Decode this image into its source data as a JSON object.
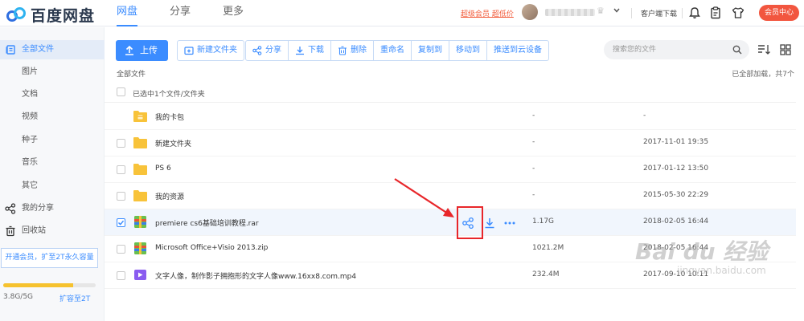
{
  "app": {
    "logo_text": "百度网盘"
  },
  "nav": {
    "items": [
      {
        "label": "网盘"
      },
      {
        "label": "分享"
      },
      {
        "label": "更多"
      }
    ]
  },
  "header": {
    "super_vip": "超级会员 超低价",
    "client_download": "客户端下载",
    "vip_center": "会员中心"
  },
  "sidebar": {
    "items": [
      {
        "label": "全部文件"
      },
      {
        "label": "图片"
      },
      {
        "label": "文档"
      },
      {
        "label": "视频"
      },
      {
        "label": "种子"
      },
      {
        "label": "音乐"
      },
      {
        "label": "其它"
      },
      {
        "label": "我的分享"
      },
      {
        "label": "回收站"
      }
    ],
    "open_vip": "开通会员，扩至2T永久容量",
    "quota": {
      "used_fraction": 0.76,
      "text": "3.8G/5G",
      "expand": "扩容至2T"
    }
  },
  "toolbar": {
    "upload": "上传",
    "new_folder": "新建文件夹",
    "share": "分享",
    "download": "下载",
    "delete": "删除",
    "rename": "重命名",
    "copy_to": "复制到",
    "move_to": "移动到",
    "push_cloud": "推送到云设备"
  },
  "search": {
    "placeholder": "搜索您的文件"
  },
  "breadcrumb": {
    "text": "全部文件"
  },
  "load_status": "已全部加载，共7个",
  "list": {
    "selected_text": "已选中1个文件/文件夹",
    "rows": [
      {
        "name": "我的卡包",
        "size": "-",
        "date": "-"
      },
      {
        "name": "新建文件夹",
        "size": "-",
        "date": "2017-11-01 19:35"
      },
      {
        "name": "PS 6",
        "size": "-",
        "date": "2017-01-12 13:50"
      },
      {
        "name": "我的资源",
        "size": "-",
        "date": "2015-05-30 22:29"
      },
      {
        "name": "premiere cs6基础培训教程.rar",
        "size": "1.17G",
        "date": "2018-02-05 16:44"
      },
      {
        "name": "Microsoft Office+Visio 2013.zip",
        "size": "1021.2M",
        "date": "2018-02-05 16:44"
      },
      {
        "name": "文字人像，制作影子拥抱形的文字人像www.16xx8.com.mp4",
        "size": "232.4M",
        "date": "2017-09-10 10:11"
      }
    ]
  },
  "watermark": {
    "main": "Bai du 经验",
    "sub": "jingyan.baidu.com"
  },
  "colors": {
    "accent": "#3b8cff",
    "vip_red": "#f2563f",
    "annotation_red": "#e8262a",
    "folder": "#f8c33a"
  }
}
